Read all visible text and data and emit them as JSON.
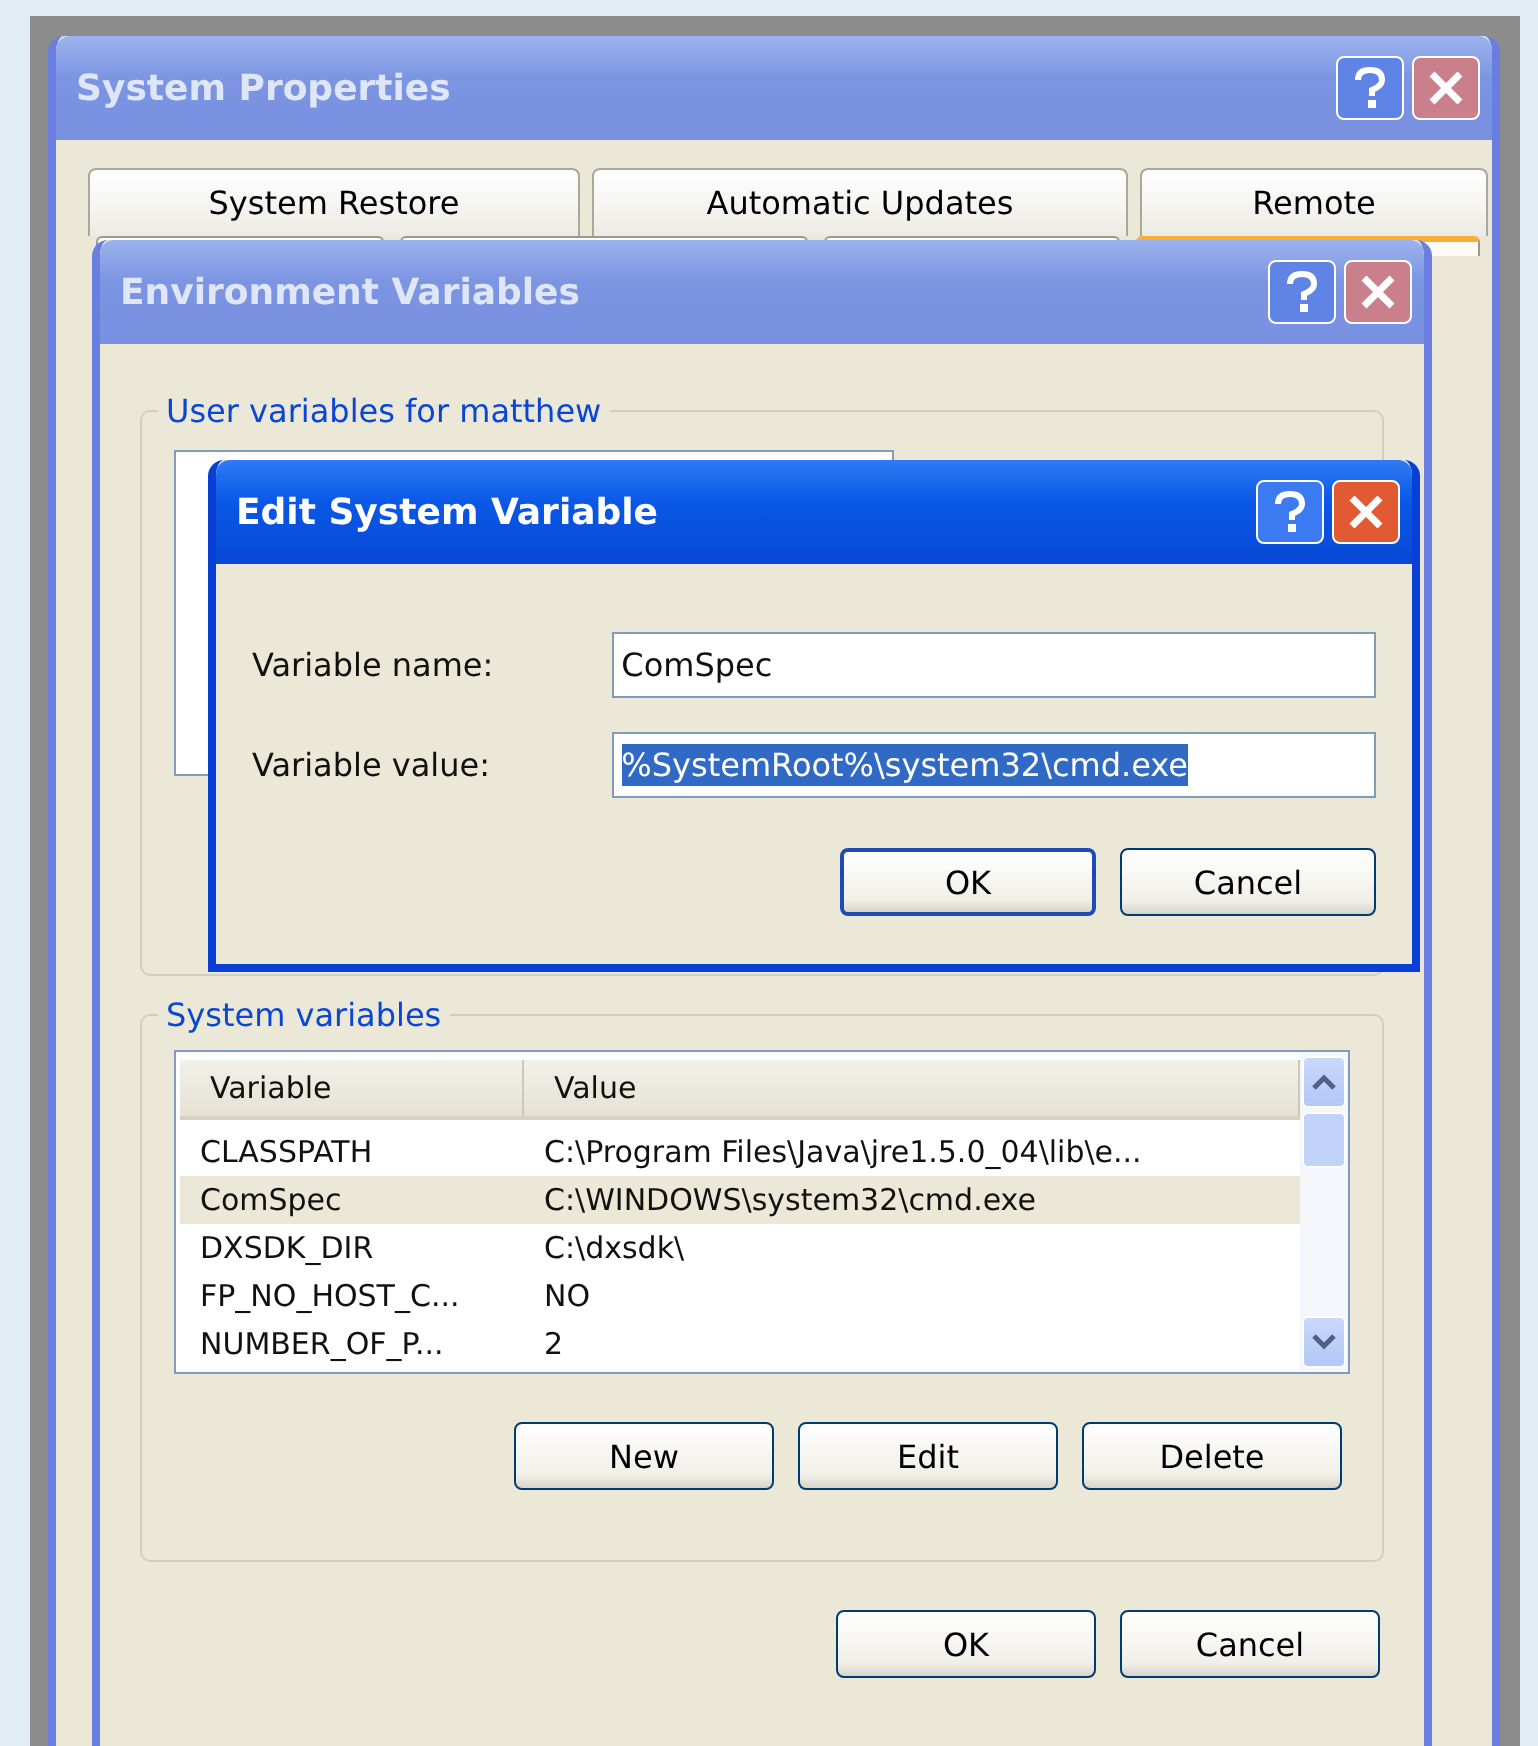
{
  "system_properties": {
    "title": "System Properties",
    "tabs": [
      {
        "label": "System Restore",
        "selected": false
      },
      {
        "label": "Automatic Updates",
        "selected": false
      },
      {
        "label": "Remote",
        "selected": false
      }
    ],
    "front_tab_row": [
      {
        "selected": false
      },
      {
        "selected": false
      },
      {
        "selected": false
      },
      {
        "selected": true
      }
    ]
  },
  "environment_variables": {
    "title": "Environment Variables",
    "user_group": {
      "title": "User variables for matthew"
    },
    "system_group": {
      "title": "System variables",
      "columns": [
        "Variable",
        "Value"
      ],
      "rows": [
        {
          "variable": "CLASSPATH",
          "value": "C:\\Program Files\\Java\\jre1.5.0_04\\lib\\e...",
          "selected": false
        },
        {
          "variable": "ComSpec",
          "value": "C:\\WINDOWS\\system32\\cmd.exe",
          "selected": true
        },
        {
          "variable": "DXSDK_DIR",
          "value": "C:\\dxsdk\\",
          "selected": false
        },
        {
          "variable": "FP_NO_HOST_C...",
          "value": "NO",
          "selected": false
        },
        {
          "variable": "NUMBER_OF_P...",
          "value": "2",
          "selected": false
        }
      ],
      "buttons": [
        "New",
        "Edit",
        "Delete"
      ]
    },
    "buttons": [
      "OK",
      "Cancel"
    ]
  },
  "edit_dialog": {
    "title": "Edit System Variable",
    "fields": [
      {
        "label": "Variable name:",
        "value": "ComSpec",
        "selected": false
      },
      {
        "label": "Variable value:",
        "value": "%SystemRoot%\\system32\\cmd.exe",
        "selected": true
      }
    ],
    "buttons": [
      {
        "label": "OK",
        "default": true
      },
      {
        "label": "Cancel",
        "default": false
      }
    ]
  }
}
